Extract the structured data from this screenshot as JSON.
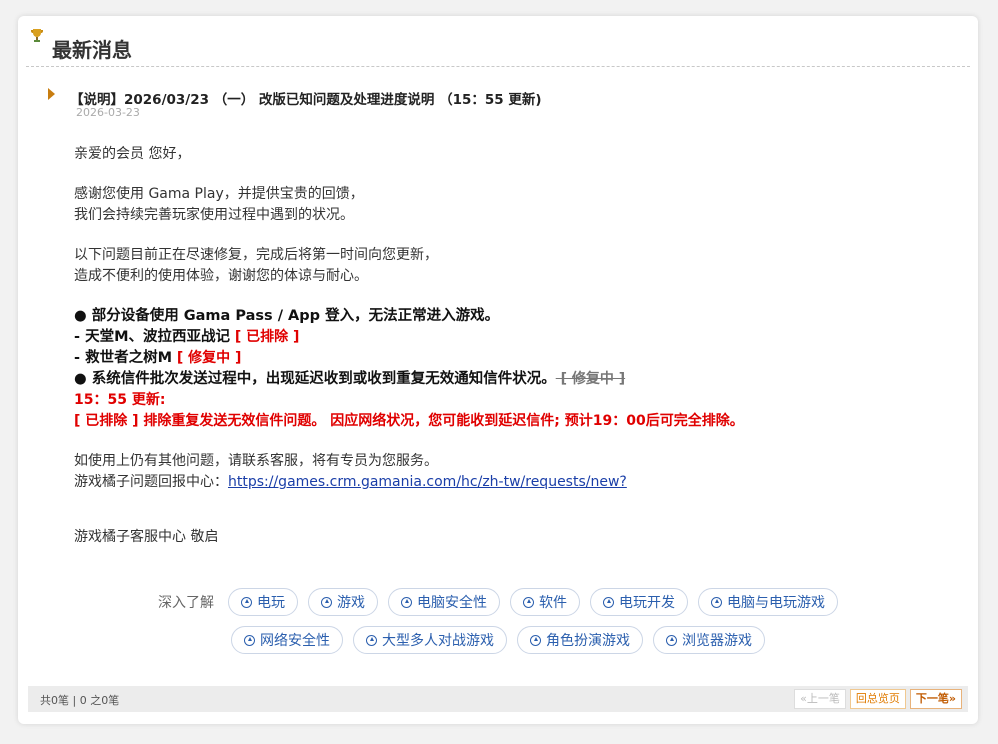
{
  "header": {
    "title": "最新消息",
    "icon": "trophy-icon"
  },
  "article": {
    "title": "【说明】2026/03/23 （一） 改版已知问题及处理进度说明 （15：55 更新)",
    "date": "2026-03-23",
    "greeting": "亲爱的会员 您好，",
    "para1_line1": "感谢您使用 Gama Play，并提供宝贵的回馈，",
    "para1_line2": "我们会持续完善玩家使用过程中遇到的状况。",
    "para2_line1": "以下问题目前正在尽速修复，完成后将第一时间向您更新，",
    "para2_line2": "造成不便利的使用体验，谢谢您的体谅与耐心。",
    "issue1": "● 部分设备使用 Gama Pass / App 登入，无法正常进入游戏。",
    "issue1_sub1": " - 天堂M、波拉西亚战记",
    "issue1_sub1_status": " [ 已排除 ]",
    "issue1_sub2": " - 救世者之树M",
    "issue1_sub2_status": " [ 修复中 ]",
    "issue2": "● 系统信件批次发送过程中，出现延迟收到或收到重复无效通知信件状况。",
    "issue2_status": " [ 修复中 ]",
    "update_time": "15：55 更新:",
    "update_text": "[ 已排除 ] 排除重复发送无效信件问题。 因应网络状况，您可能收到延迟信件; 预计19：00后可完全排除。",
    "contact_line1": "如使用上仍有其他问题，请联系客服，将有专员为您服务。",
    "contact_line2_label": "游戏橘子问题回报中心：",
    "contact_link": "https://games.crm.gamania.com/hc/zh-tw/requests/new? ",
    "signature": "游戏橘子客服中心 敬启"
  },
  "tags": {
    "label": "深入了解",
    "row1": [
      "电玩",
      "游戏",
      "电脑安全性",
      "软件",
      "电玩开发",
      "电脑与电玩游戏"
    ],
    "row2": [
      "网络安全性",
      "大型多人对战游戏",
      "角色扮演游戏",
      "浏览器游戏"
    ]
  },
  "footer": {
    "count": "共0笔 | 0 之0笔",
    "prev": "«上一笔",
    "back": "回总览页",
    "next": "下一笔»"
  },
  "colors": {
    "red": "#e00000",
    "link": "#1a3ea8",
    "tag_blue": "#2b5fae",
    "orange": "#e07b00"
  }
}
